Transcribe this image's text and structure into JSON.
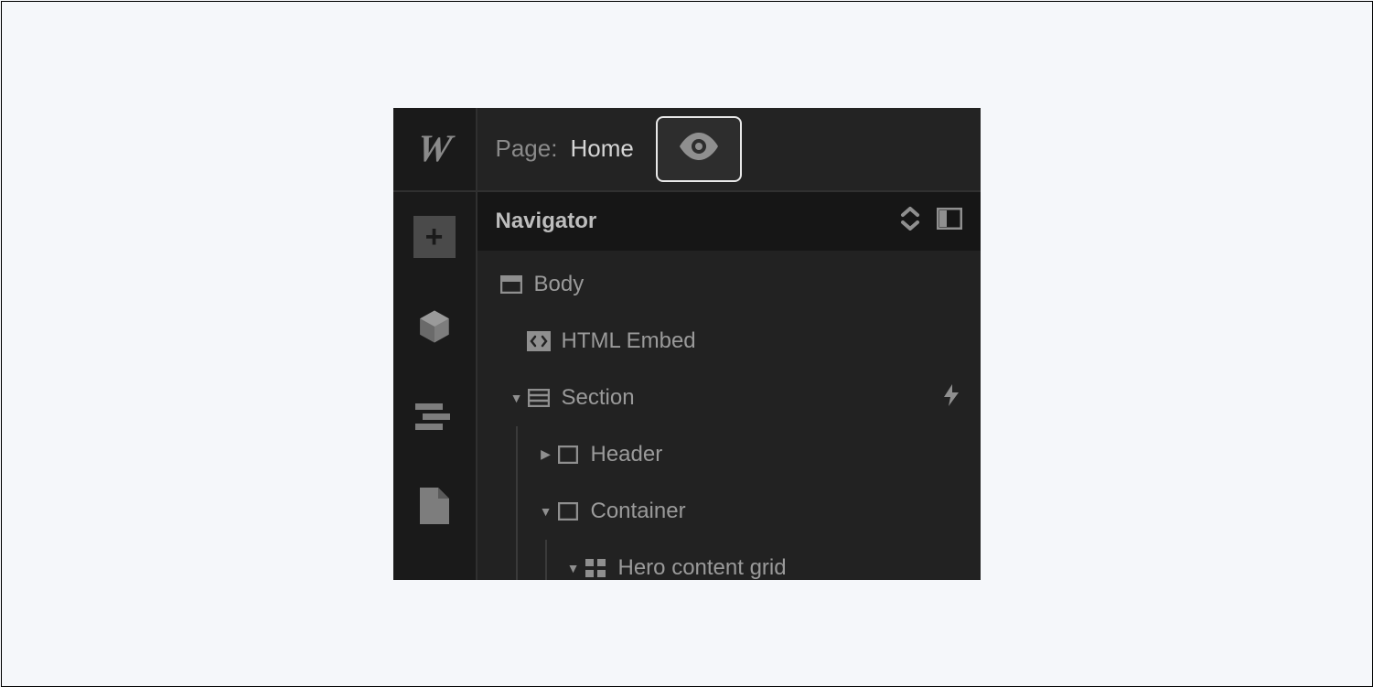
{
  "topbar": {
    "page_label": "Page:",
    "page_name": "Home"
  },
  "navigator": {
    "title": "Navigator"
  },
  "tree": {
    "body": "Body",
    "embed": "HTML Embed",
    "section": "Section",
    "header": "Header",
    "container": "Container",
    "hero": "Hero content grid"
  }
}
